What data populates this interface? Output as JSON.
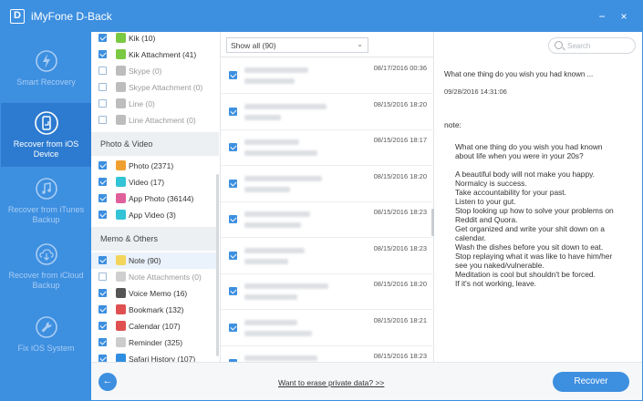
{
  "window": {
    "app_name": "iMyFone D-Back",
    "logo_letter": "D",
    "minimize": "−",
    "close": "×"
  },
  "sidebar": {
    "items": [
      {
        "label": "Smart Recovery",
        "icon": "lightning-icon",
        "active": false
      },
      {
        "label": "Recover from iOS Device",
        "icon": "phone-refresh-icon",
        "active": true
      },
      {
        "label": "Recover from iTunes Backup",
        "icon": "music-refresh-icon",
        "active": false
      },
      {
        "label": "Recover from iCloud Backup",
        "icon": "cloud-download-icon",
        "active": false
      },
      {
        "label": "Fix iOS System",
        "icon": "wrench-icon",
        "active": false
      }
    ]
  },
  "categories": {
    "rows_top": [
      {
        "label": "Kik (10)",
        "checked": true,
        "dim": false,
        "icon": "kik-icon",
        "color": "#7ac943"
      },
      {
        "label": "Kik Attachment (41)",
        "checked": true,
        "dim": false,
        "icon": "kik-icon",
        "color": "#7ac943"
      },
      {
        "label": "Skype (0)",
        "checked": false,
        "dim": true,
        "icon": "skype-icon",
        "color": "#bdbdbd"
      },
      {
        "label": "Skype Attachment (0)",
        "checked": false,
        "dim": true,
        "icon": "skype-icon",
        "color": "#bdbdbd"
      },
      {
        "label": "Line (0)",
        "checked": false,
        "dim": true,
        "icon": "line-icon",
        "color": "#bdbdbd"
      },
      {
        "label": "Line Attachment (0)",
        "checked": false,
        "dim": true,
        "icon": "line-icon",
        "color": "#bdbdbd"
      }
    ],
    "photo_video_header": "Photo & Video",
    "photo_video": [
      {
        "label": "Photo (2371)",
        "checked": true,
        "dim": false,
        "icon": "photos-icon",
        "color": "#f0a030"
      },
      {
        "label": "Video (17)",
        "checked": true,
        "dim": false,
        "icon": "clapperboard-icon",
        "color": "#33c3d6"
      },
      {
        "label": "App Photo (36144)",
        "checked": true,
        "dim": false,
        "icon": "photos-icon",
        "color": "#e0609c"
      },
      {
        "label": "App Video (3)",
        "checked": true,
        "dim": false,
        "icon": "clapperboard-icon",
        "color": "#33c3d6"
      }
    ],
    "memo_header": "Memo & Others",
    "memo": [
      {
        "label": "Note (90)",
        "checked": true,
        "dim": false,
        "icon": "note-icon",
        "color": "#f3d55b",
        "selected": true
      },
      {
        "label": "Note Attachments (0)",
        "checked": false,
        "dim": true,
        "icon": "note-icon",
        "color": "#cfcfcf"
      },
      {
        "label": "Voice Memo (16)",
        "checked": true,
        "dim": false,
        "icon": "voice-memo-icon",
        "color": "#555555"
      },
      {
        "label": "Bookmark (132)",
        "checked": true,
        "dim": false,
        "icon": "bookmark-icon",
        "color": "#e05050"
      },
      {
        "label": "Calendar (107)",
        "checked": true,
        "dim": false,
        "icon": "calendar-icon",
        "color": "#e05050"
      },
      {
        "label": "Reminder (325)",
        "checked": true,
        "dim": false,
        "icon": "reminder-icon",
        "color": "#cccccc"
      },
      {
        "label": "Safari History (107)",
        "checked": true,
        "dim": false,
        "icon": "safari-icon",
        "color": "#2f8ee0"
      }
    ]
  },
  "list": {
    "filter_label": "Show all (90)",
    "filter_arrow": "⌄",
    "rows": [
      {
        "date": "08/17/2016 00:36",
        "selected": false
      },
      {
        "date": "08/15/2016 18:20",
        "selected": false
      },
      {
        "date": "08/15/2016 18:17",
        "selected": false
      },
      {
        "date": "08/15/2016 18:20",
        "selected": false
      },
      {
        "date": "08/15/2016 18:23",
        "selected": false
      },
      {
        "date": "08/15/2016 18:23",
        "selected": false
      },
      {
        "date": "08/15/2016 18:20",
        "selected": false
      },
      {
        "date": "08/15/2016 18:21",
        "selected": false
      },
      {
        "date": "08/15/2016 18:23",
        "selected": false
      }
    ]
  },
  "detail": {
    "search_placeholder": "Search",
    "title": "What one thing do you wish you had known ...",
    "date": "09/28/2016 14:31:06",
    "note_label": "note:",
    "body_lines": [
      "What one thing do you wish you had known",
      "about life when you were in your 20s?",
      "",
      "A beautiful body will not make you happy.",
      "Normalcy is success.",
      "Take accountability for your past.",
      "Listen to your gut.",
      "Stop looking up how to solve your problems on",
      "Reddit and Quora.",
      "Get organized and write your shit down on a",
      "calendar.",
      "Wash the dishes before you sit down to eat.",
      "Stop replaying what it was like to have him/her",
      "see you naked/vulnerable.",
      "Meditation is cool but shouldn't be forced.",
      "If it's not working, leave."
    ]
  },
  "bottom": {
    "back_arrow": "←",
    "erase_link": "Want to erase private data? >>",
    "recover_button": "Recover"
  },
  "colors": {
    "accent": "#3d8fe0",
    "sidebar_active": "#2d7bd0"
  }
}
